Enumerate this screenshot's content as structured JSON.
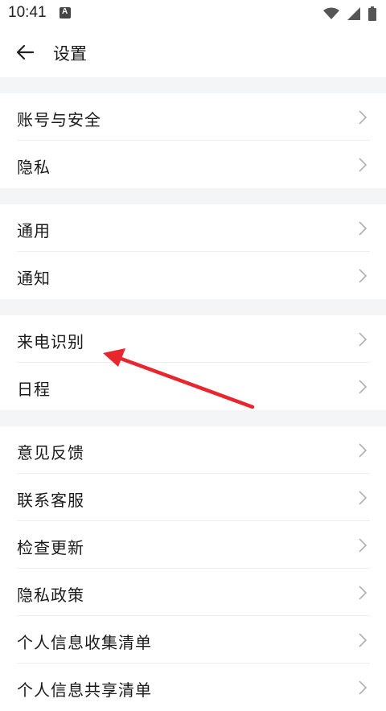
{
  "status_bar": {
    "time": "10:41",
    "app_icon": "a-icon",
    "icons": [
      "wifi-icon",
      "signal-icon",
      "battery-icon"
    ]
  },
  "header": {
    "back_icon": "back-arrow-icon",
    "title": "设置"
  },
  "groups": [
    {
      "items": [
        {
          "label": "账号与安全"
        },
        {
          "label": "隐私"
        }
      ]
    },
    {
      "items": [
        {
          "label": "通用"
        },
        {
          "label": "通知"
        }
      ]
    },
    {
      "items": [
        {
          "label": "来电识别"
        },
        {
          "label": "日程"
        }
      ]
    },
    {
      "items": [
        {
          "label": "意见反馈"
        },
        {
          "label": "联系客服"
        },
        {
          "label": "检查更新"
        },
        {
          "label": "隐私政策"
        },
        {
          "label": "个人信息收集清单"
        },
        {
          "label": "个人信息共享清单"
        }
      ]
    }
  ],
  "row_icon": "chevron-right-icon",
  "annotation": {
    "icon": "red-arrow-icon",
    "color": "#e8262d"
  },
  "colors": {
    "background": "#ffffff",
    "section_gap": "#f4f5f7",
    "text": "#1a1a1a",
    "chevron": "#b0b0b0"
  }
}
